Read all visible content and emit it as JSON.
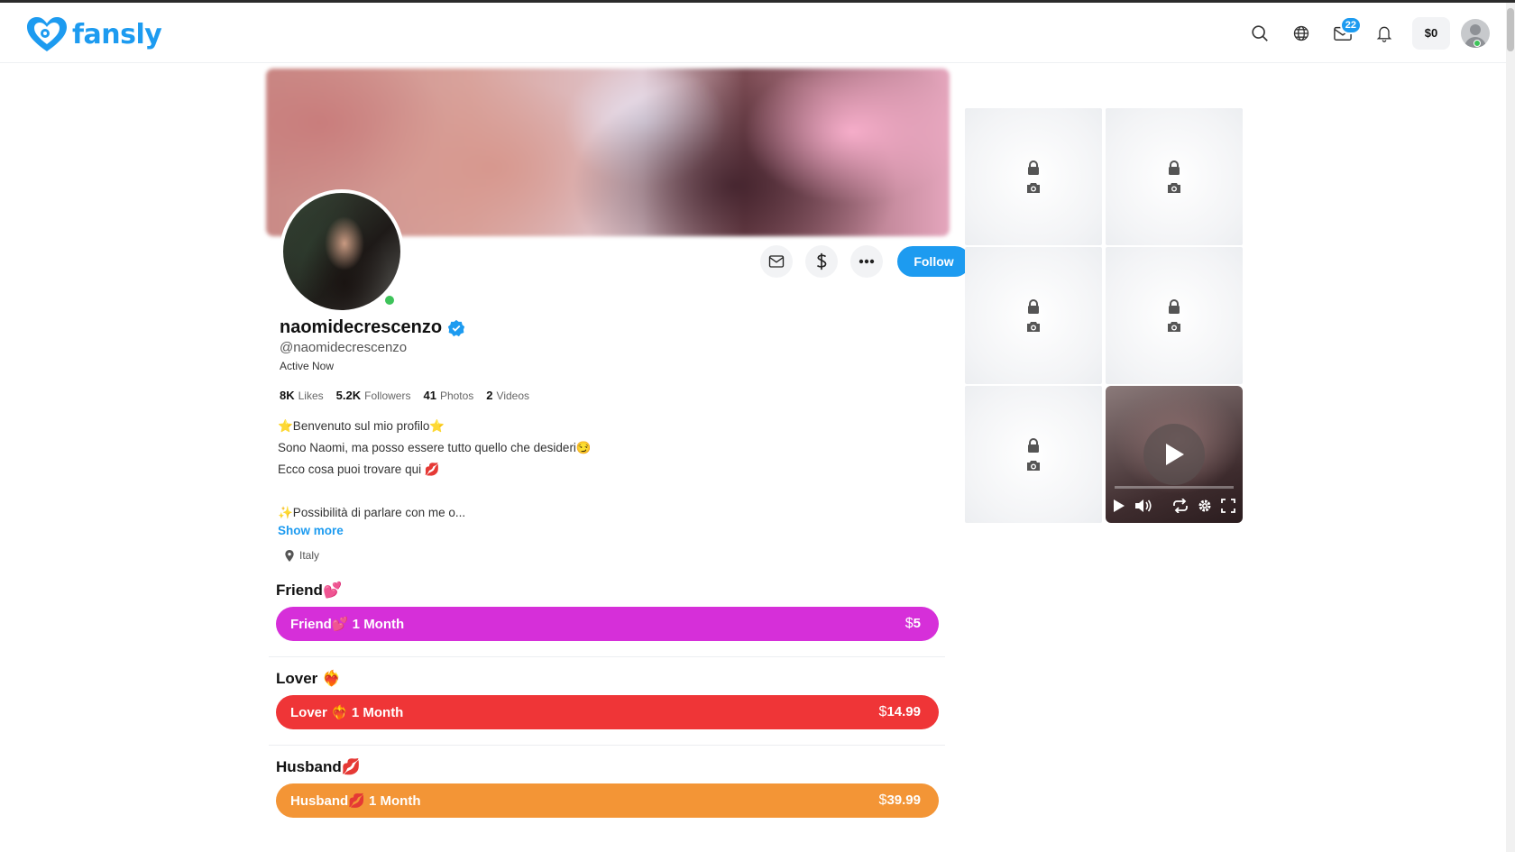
{
  "brand": {
    "name": "fansly",
    "color": "#1d9bf0"
  },
  "header": {
    "icons": [
      "search-icon",
      "globe-icon",
      "mail-icon",
      "bell-icon"
    ],
    "messages_badge": "22",
    "wallet_balance": "$0"
  },
  "profile": {
    "display_name": "naomidecrescenzo",
    "handle": "@naomidecrescenzo",
    "status": "Active Now",
    "verified": true,
    "follow_label": "Follow",
    "stats": [
      {
        "value": "8K",
        "label": "Likes"
      },
      {
        "value": "5.2K",
        "label": "Followers"
      },
      {
        "value": "41",
        "label": "Photos"
      },
      {
        "value": "2",
        "label": "Videos"
      }
    ],
    "bio": [
      "⭐Benvenuto sul mio profilo⭐",
      "Sono Naomi, ma posso essere tutto quello che desideri😏",
      "Ecco cosa puoi trovare qui 💋",
      "",
      "✨Possibilità di parlare con me o..."
    ],
    "show_more": "Show more",
    "location": "Italy"
  },
  "tiers": [
    {
      "title": "Friend💕",
      "button_label": "Friend💕 1 Month",
      "currency": "$",
      "price": "5",
      "color": "#d62fd9"
    },
    {
      "title": "Lover ❤️‍🔥",
      "button_label": "Lover ❤️‍🔥 1 Month",
      "currency": "$",
      "price": "14.99",
      "color": "#ef3537"
    },
    {
      "title": "Husband💋",
      "button_label": "Husband💋 1 Month",
      "currency": "$",
      "price": "39.99",
      "color": "#f39536"
    }
  ],
  "media": {
    "locked_tiles": 5,
    "tile_icons": [
      "lock-icon",
      "camera-icon"
    ],
    "video_controls": [
      "play-icon",
      "volume-icon",
      "loop-icon",
      "settings-icon",
      "fullscreen-icon"
    ]
  }
}
